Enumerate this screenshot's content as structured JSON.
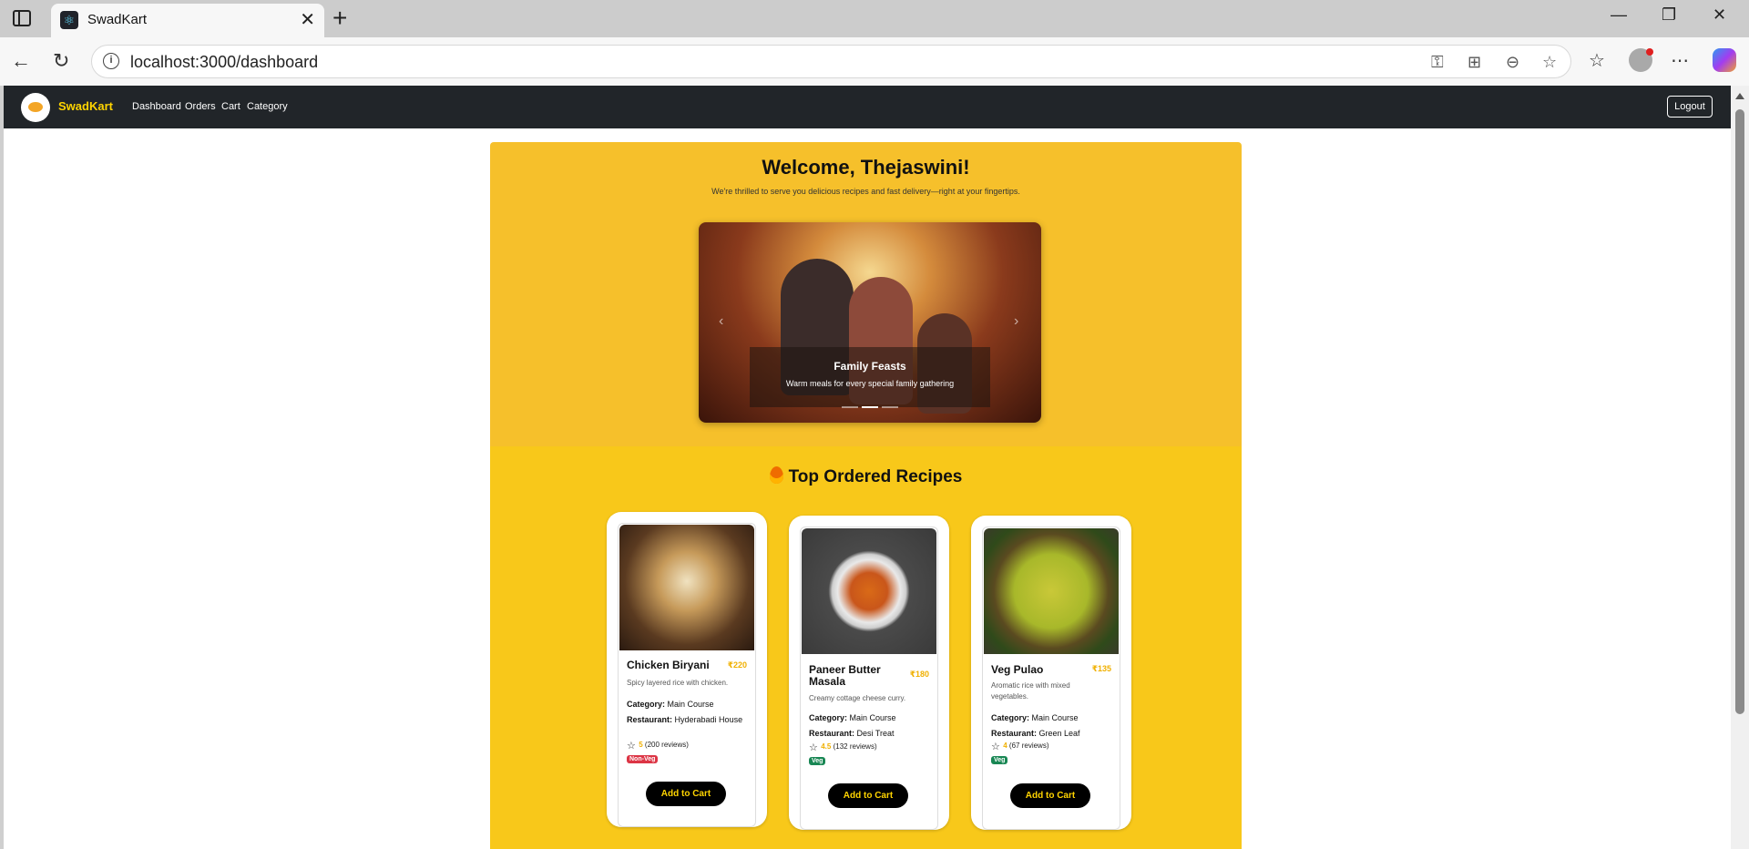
{
  "browser": {
    "tab_title": "SwadKart",
    "url": "localhost:3000/dashboard"
  },
  "navbar": {
    "brand": "SwadKart",
    "links": [
      "Dashboard",
      "Orders",
      "Cart",
      "Category"
    ],
    "logout_label": "Logout"
  },
  "hero": {
    "title": "Welcome, Thejaswini!",
    "subtitle": "We're thrilled to serve you delicious recipes and fast delivery—right at your fingertips."
  },
  "carousel": {
    "caption_title": "Family Feasts",
    "caption_text": "Warm meals for every special family gathering",
    "slide_count": 3,
    "active_slide": 2
  },
  "recipes_section": {
    "title": "Top Ordered Recipes",
    "cards": [
      {
        "name": "Chicken Biryani",
        "price": "₹220",
        "description": "Spicy layered rice with chicken.",
        "category_label": "Category:",
        "category": "Main Course",
        "restaurant_label": "Restaurant:",
        "restaurant": "Hyderabadi House",
        "rating": "5",
        "reviews": "(200 reviews)",
        "badge": "Non-Veg",
        "button": "Add to Cart"
      },
      {
        "name": "Paneer Butter Masala",
        "price": "₹180",
        "description": "Creamy cottage cheese curry.",
        "category_label": "Category:",
        "category": "Main Course",
        "restaurant_label": "Restaurant:",
        "restaurant": "Desi Treat",
        "rating": "4.5",
        "reviews": "(132 reviews)",
        "badge": "Veg",
        "button": "Add to Cart"
      },
      {
        "name": "Veg Pulao",
        "price": "₹135",
        "description": "Aromatic rice with mixed vegetables.",
        "category_label": "Category:",
        "category": "Main Course",
        "restaurant_label": "Restaurant:",
        "restaurant": "Green Leaf",
        "rating": "4",
        "reviews": "(67 reviews)",
        "badge": "Veg",
        "button": "Add to Cart"
      }
    ]
  },
  "colors": {
    "navbar_bg": "#212529",
    "brand_yellow": "#ffd400",
    "hero_bg": "#f6c02b",
    "recipes_bg": "#f8c81a",
    "nonveg_badge": "#dc3545",
    "veg_badge": "#198754"
  }
}
